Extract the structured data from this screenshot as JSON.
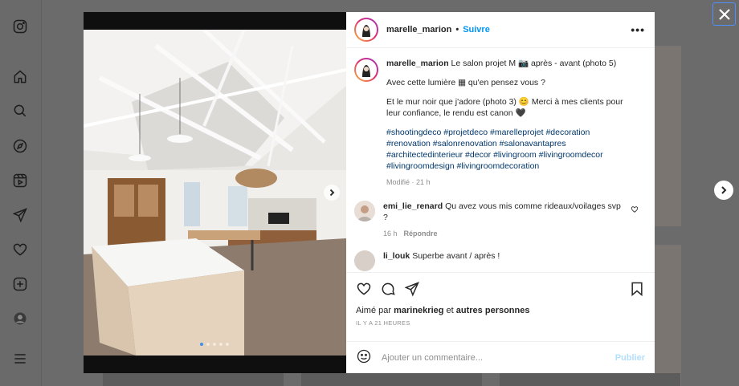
{
  "sidebar": {
    "items": [
      {
        "icon": "instagram-icon"
      },
      {
        "icon": "home-icon"
      },
      {
        "icon": "search-icon"
      },
      {
        "icon": "explore-icon"
      },
      {
        "icon": "reels-icon"
      },
      {
        "icon": "messages-icon"
      },
      {
        "icon": "heart-icon"
      },
      {
        "icon": "create-icon"
      },
      {
        "icon": "profile-avatar"
      },
      {
        "icon": "menu-icon"
      }
    ]
  },
  "post": {
    "username": "marelle_marion",
    "separator": "•",
    "follow_label": "Suivre",
    "more_label": "•••",
    "caption": {
      "username": "marelle_marion",
      "line1": "Le salon projet M 📷 après - avant (photo 5)",
      "line2": "Avec cette lumière ▦ qu'en pensez vous ?",
      "line3": "Et le mur noir que j'adore (photo 3) 😊 Merci à mes clients pour leur confiance, le rendu est canon 🖤",
      "hashtags": "#shootingdeco #projetdeco #marelleprojet #decoration #renovation #salonrenovation #salonavantapres #architectedinterieur #decor #livingroom #livingroomdecor #livingroomdesign #livingroomdecoration",
      "meta": "Modifié · 21 h"
    },
    "comments": [
      {
        "username": "emi_lie_renard",
        "text": "Qu avez vous mis comme rideaux/voilages svp ?",
        "age": "16 h",
        "reply_label": "Répondre"
      },
      {
        "username": "li_louk",
        "text": "Superbe avant / après !"
      }
    ],
    "likes": {
      "prefix": "Aimé par",
      "user": "marinekrieg",
      "mid": "et",
      "others": "autres personnes"
    },
    "timestamp": "IL Y A 21 HEURES",
    "add_comment": {
      "placeholder": "Ajouter un commentaire...",
      "publish_label": "Publier"
    },
    "carousel": {
      "count": 5,
      "active": 1
    }
  },
  "colors": {
    "accent": "#0095f6",
    "hashtag": "#00376b",
    "publish_disabled": "#b2dffc"
  }
}
